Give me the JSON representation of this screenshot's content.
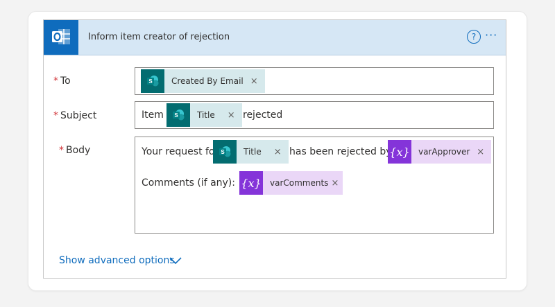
{
  "action": {
    "title": "Inform item creator of rejection",
    "help_glyph": "?",
    "more_glyph": "···",
    "app_icon": "outlook-icon"
  },
  "fields": {
    "to": {
      "required_marker": "*",
      "label": "To",
      "tokens": [
        {
          "type": "sharepoint",
          "label": "Created By Email",
          "remove": "×"
        }
      ]
    },
    "subject": {
      "required_marker": "*",
      "label": "Subject",
      "text_before": "Item",
      "token": {
        "type": "sharepoint",
        "label": "Title",
        "remove": "×"
      },
      "text_after": "rejected"
    },
    "body": {
      "required_marker": "*",
      "label": "Body",
      "line1_text": "Your request for",
      "line1_token1": {
        "type": "sharepoint",
        "label": "Title",
        "remove": "×"
      },
      "line1_mid": "has been rejected by",
      "line1_token2": {
        "type": "variable",
        "icon_glyph": "{x}",
        "label": "varApprover",
        "remove": "×"
      },
      "line2_text": "Comments (if any):",
      "line2_token": {
        "type": "variable",
        "icon_glyph": "{x}",
        "label": "varComments",
        "remove": "×"
      }
    }
  },
  "advanced": {
    "label": "Show advanced options"
  },
  "colors": {
    "header_bg": "#d6e7f5",
    "accent": "#0f6cbd",
    "sharepoint": "#036c70",
    "variable": "#8434d9",
    "required": "#d13438"
  }
}
